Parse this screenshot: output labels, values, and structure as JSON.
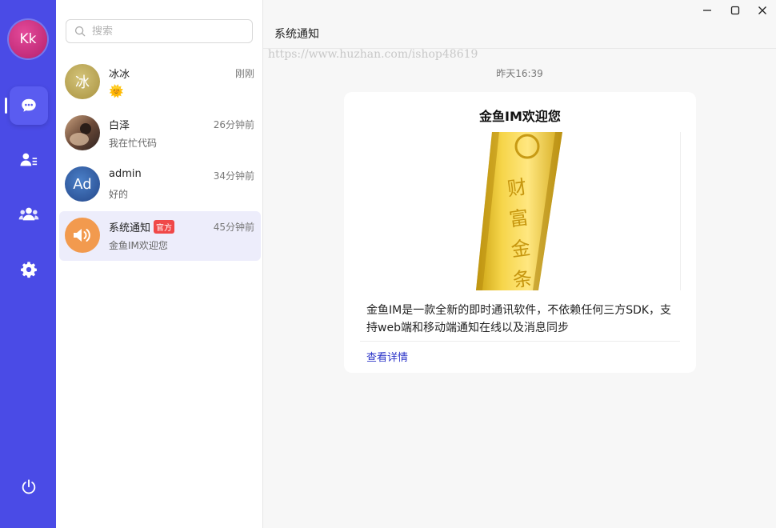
{
  "user": {
    "initials": "Kk"
  },
  "search": {
    "placeholder": "搜索"
  },
  "conversations": [
    {
      "name": "冰冰",
      "time": "刚刚",
      "message": "🌞",
      "avatar_text": "冰",
      "avatar_color": "#b8a24e"
    },
    {
      "name": "白泽",
      "time": "26分钟前",
      "message": "我在忙代码",
      "avatar_text": "",
      "avatar_color": "#6b4a3a"
    },
    {
      "name": "admin",
      "time": "34分钟前",
      "message": "好的",
      "avatar_text": "Ad",
      "avatar_color": "#2f5fa8"
    },
    {
      "name": "系统通知",
      "badge": "官方",
      "time": "45分钟前",
      "message": "金鱼IM欢迎您",
      "avatar_color": "#f29a4e"
    }
  ],
  "chat": {
    "title": "系统通知",
    "watermark": "https://www.huzhan.com/ishop48619",
    "timestamp": "昨天16:39",
    "card": {
      "title": "金鱼IM欢迎您",
      "image_text": "财富金条",
      "description": "金鱼IM是一款全新的即时通讯软件，不依赖任何三方SDK，支持web端和移动端通知在线以及消息同步",
      "link": "查看详情"
    }
  },
  "colors": {
    "rail": "#4a4be6",
    "active_item": "#ededfb",
    "badge": "#f04848",
    "link": "#2a33c8"
  }
}
